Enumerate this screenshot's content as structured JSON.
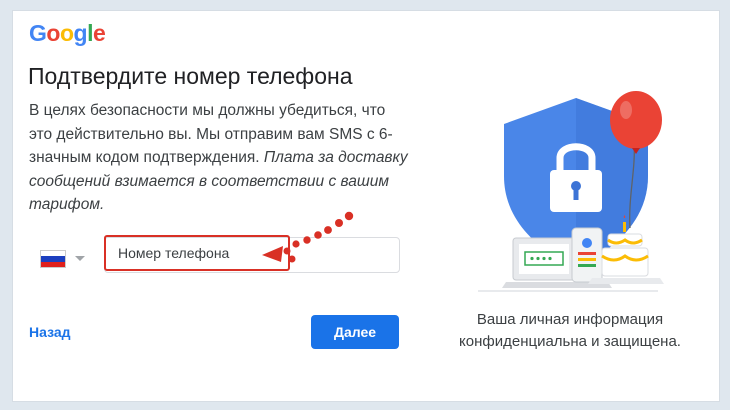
{
  "brand": {
    "logo_letters": [
      "G",
      "o",
      "o",
      "g",
      "l",
      "e"
    ],
    "logo_colors": [
      "#4285f4",
      "#ea4335",
      "#fbbc05",
      "#4285f4",
      "#34a853",
      "#ea4335"
    ]
  },
  "page": {
    "title": "Подтвердите номер телефона",
    "description_plain": "В целях безопасности мы должны убедиться, что это действительно вы. Мы отправим вам SMS с 6-значным кодом подтверждения. ",
    "description_italic": "Плата за доставку сообщений взимается в соответствии с вашим тарифом."
  },
  "phone": {
    "country_flag": "russia-flag",
    "placeholder": "Номер телефона"
  },
  "actions": {
    "back_label": "Назад",
    "next_label": "Далее"
  },
  "privacy": {
    "line1": "Ваша личная информация",
    "line2": "конфиденциальна и защищена."
  },
  "colors": {
    "accent": "#1a73e8",
    "highlight": "#d93025",
    "shield": "#4a86e8",
    "balloon": "#ea4335"
  }
}
